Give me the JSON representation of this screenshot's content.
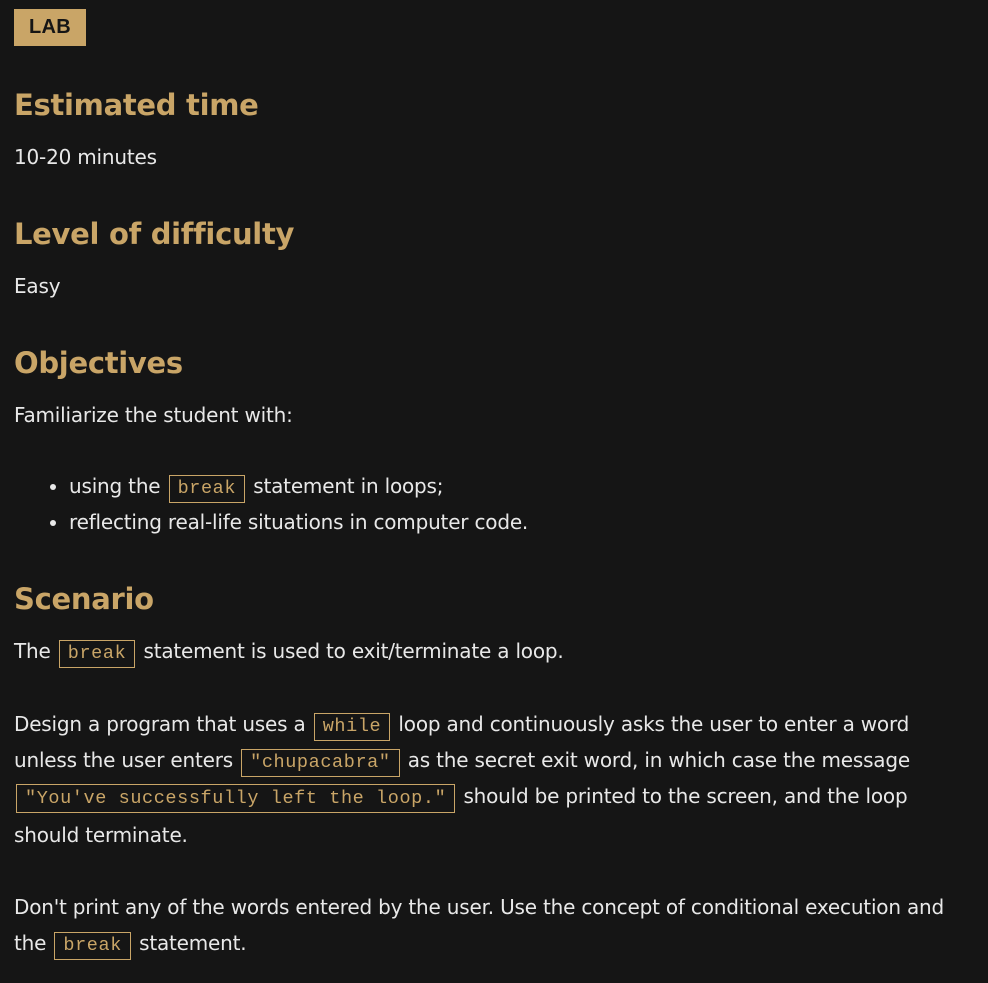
{
  "badge": "LAB",
  "estimated_time": {
    "heading": "Estimated time",
    "value": "10-20 minutes"
  },
  "difficulty": {
    "heading": "Level of difficulty",
    "value": "Easy"
  },
  "objectives": {
    "heading": "Objectives",
    "intro": "Familiarize the student with:",
    "item1_pre": "using the",
    "item1_code": "break",
    "item1_post": "statement in loops;",
    "item2": "reflecting real-life situations in computer code."
  },
  "scenario": {
    "heading": "Scenario",
    "p1_pre": "The",
    "p1_code": "break",
    "p1_post": "statement is used to exit/terminate a loop.",
    "p2_a": "Design a program that uses a",
    "p2_code1": "while",
    "p2_b": "loop and continuously asks the user to enter a word unless the user enters",
    "p2_code2": "\"chupacabra\"",
    "p2_c": "as the secret exit word, in which case the message",
    "p2_code3": "\"You've successfully left the loop.\"",
    "p2_d": "should be printed to the screen, and the loop should terminate.",
    "p3_a": "Don't print any of the words entered by the user. Use the concept of conditional execution and the",
    "p3_code": "break",
    "p3_b": "statement."
  }
}
